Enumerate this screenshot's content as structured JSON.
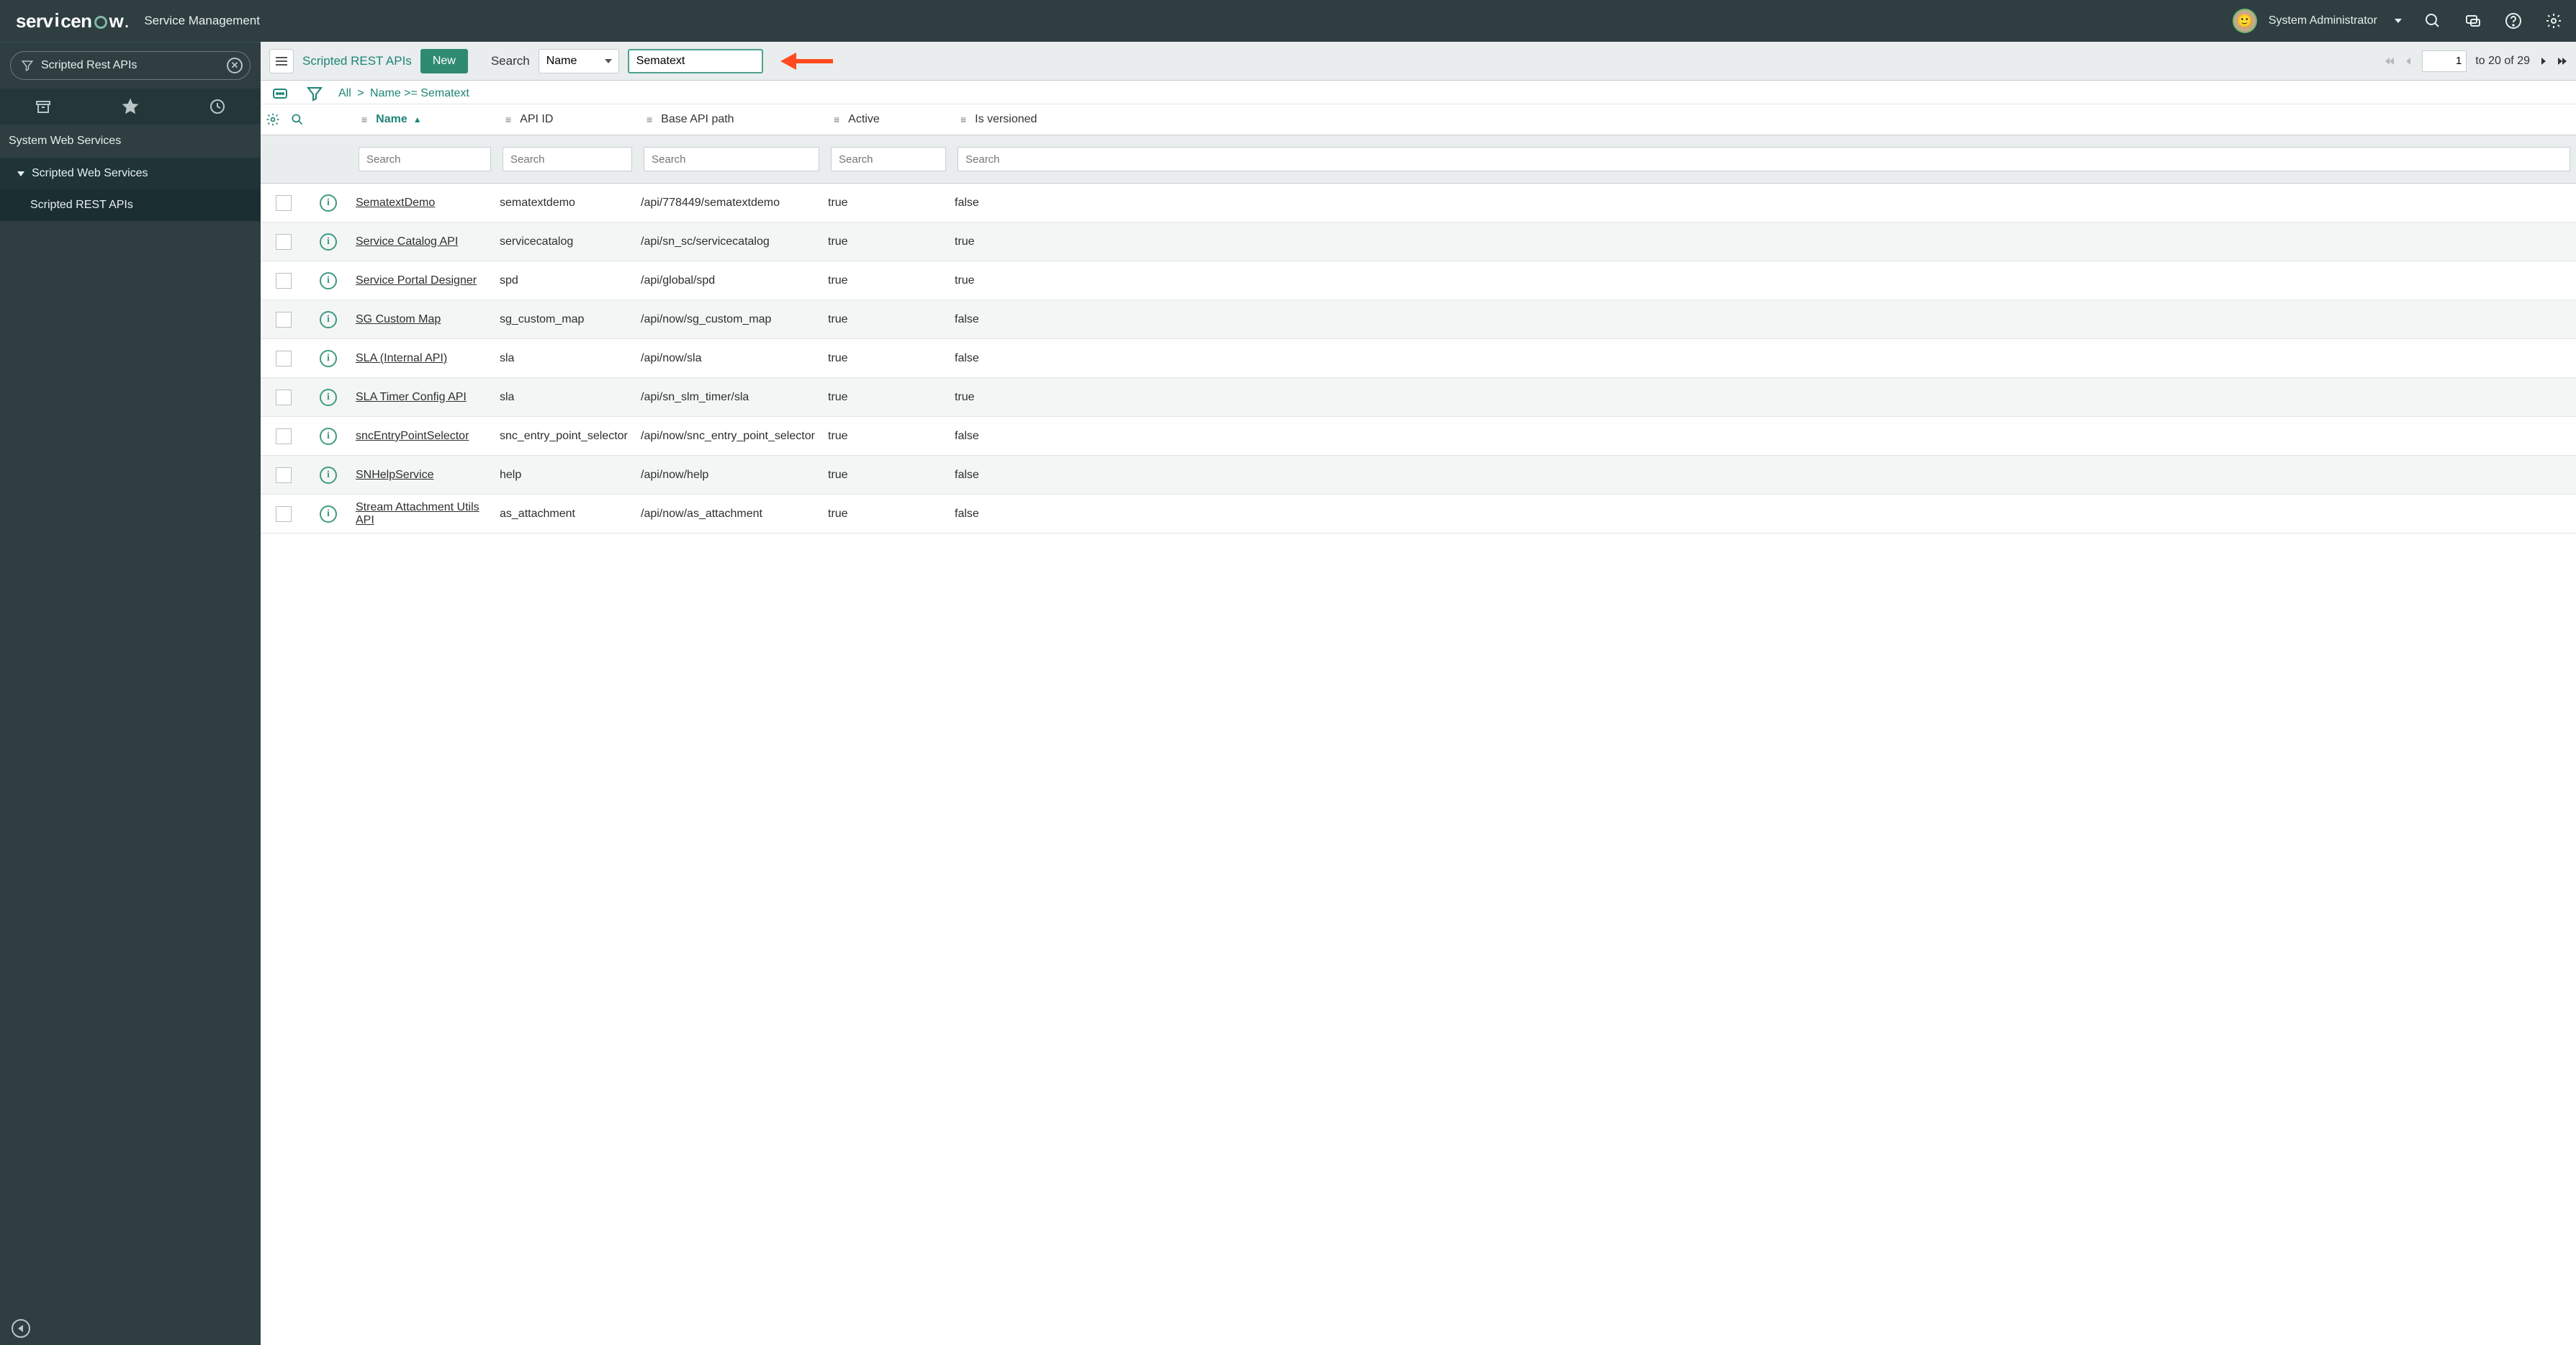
{
  "header": {
    "app_title": "Service Management",
    "user_name": "System Administrator"
  },
  "sidebar": {
    "filter_value": "Scripted Rest APIs",
    "section_label": "System Web Services",
    "group_label": "Scripted Web Services",
    "item_label": "Scripted REST APIs"
  },
  "toolbar": {
    "list_title": "Scripted REST APIs",
    "new_label": "New",
    "search_label": "Search",
    "search_field_selected": "Name",
    "search_value": "Sematext",
    "page_current": "1",
    "page_to": "to",
    "page_end": "20",
    "page_of": "of",
    "page_total": "29"
  },
  "breadcrumb": {
    "all": "All",
    "filter": "Name >= Sematext"
  },
  "columns": {
    "name": "Name",
    "api_id": "API ID",
    "base_path": "Base API path",
    "active": "Active",
    "versioned": "Is versioned",
    "search_placeholder": "Search"
  },
  "rows": [
    {
      "name": "SematextDemo",
      "api_id": "sematextdemo",
      "path": "/api/778449/sematextdemo",
      "active": "true",
      "versioned": "false"
    },
    {
      "name": "Service Catalog API",
      "api_id": "servicecatalog",
      "path": "/api/sn_sc/servicecatalog",
      "active": "true",
      "versioned": "true"
    },
    {
      "name": "Service Portal Designer",
      "api_id": "spd",
      "path": "/api/global/spd",
      "active": "true",
      "versioned": "true"
    },
    {
      "name": "SG Custom Map",
      "api_id": "sg_custom_map",
      "path": "/api/now/sg_custom_map",
      "active": "true",
      "versioned": "false"
    },
    {
      "name": "SLA (Internal API)",
      "api_id": "sla",
      "path": "/api/now/sla",
      "active": "true",
      "versioned": "false"
    },
    {
      "name": "SLA Timer Config API",
      "api_id": "sla",
      "path": "/api/sn_slm_timer/sla",
      "active": "true",
      "versioned": "true"
    },
    {
      "name": "sncEntryPointSelector",
      "api_id": "snc_entry_point_selector",
      "path": "/api/now/snc_entry_point_selector",
      "active": "true",
      "versioned": "false"
    },
    {
      "name": "SNHelpService",
      "api_id": "help",
      "path": "/api/now/help",
      "active": "true",
      "versioned": "false"
    },
    {
      "name": "Stream Attachment Utils API",
      "api_id": "as_attachment",
      "path": "/api/now/as_attachment",
      "active": "true",
      "versioned": "false"
    }
  ]
}
